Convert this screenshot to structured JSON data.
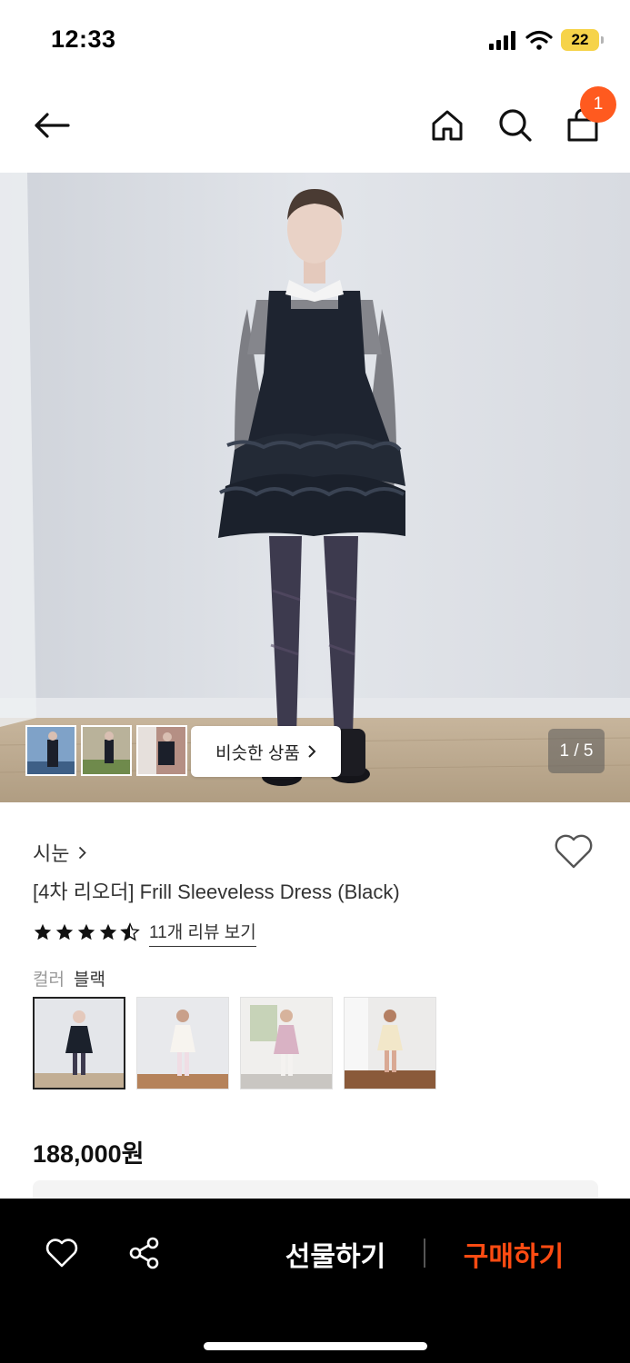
{
  "status_bar": {
    "time": "12:33",
    "battery": "22"
  },
  "nav": {
    "cart_count": "1"
  },
  "hero": {
    "similar_label": "비슷한 상품",
    "page_counter": "1 / 5"
  },
  "product": {
    "brand": "시눈",
    "title": "[4차 리오더] Frill Sleeveless Dress (Black)",
    "rating": 4.5,
    "review_link": "11개 리뷰 보기",
    "color_label": "컬러",
    "color_value": "블랙",
    "price": "188,000원"
  },
  "bottom_bar": {
    "gift_label": "선물하기",
    "buy_label": "구매하기"
  },
  "colors": {
    "accent_orange": "#ff5a1f",
    "buy_text": "#ff4b12"
  }
}
